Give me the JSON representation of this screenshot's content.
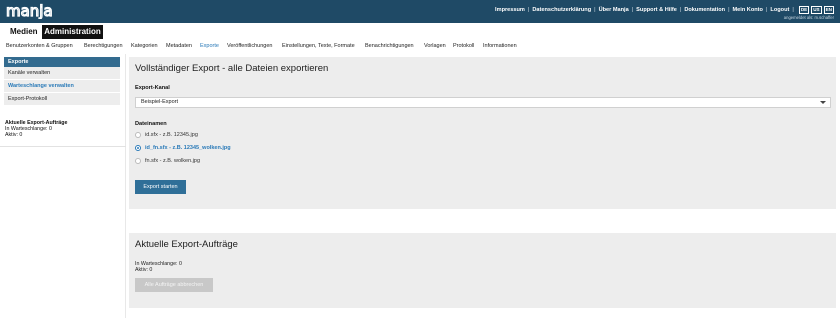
{
  "header": {
    "logo_text": "manja",
    "links": [
      "Impressum",
      "Datenschutzerklärung",
      "Über Manja",
      "Support & Hilfe",
      "Dokumentation",
      "Mein Konto",
      "Logout"
    ],
    "languages": [
      "DE",
      "US",
      "EN"
    ],
    "logged_in": "angemeldet als: m.schaffer"
  },
  "main_tabs": [
    {
      "label": "Medien",
      "active": false
    },
    {
      "label": "Administration",
      "active": true
    }
  ],
  "subnav": [
    {
      "label": "Benutzerkonten & Gruppen",
      "active": false
    },
    {
      "label": "Berechtigungen",
      "active": false
    },
    {
      "label": "Kategorien",
      "active": false
    },
    {
      "label": "Metadaten",
      "active": false
    },
    {
      "label": "Exporte",
      "active": true
    },
    {
      "label": "Veröffentlichungen",
      "active": false
    },
    {
      "label": "Einstellungen, Texte, Formate",
      "active": false
    },
    {
      "label": "Benachrichtigungen",
      "active": false
    },
    {
      "label": "Vorlagen",
      "active": false
    },
    {
      "label": "Protokoll",
      "active": false
    },
    {
      "label": "Informationen",
      "active": false
    }
  ],
  "sidebar": {
    "heading": "Exporte",
    "items": [
      {
        "label": "Kanäle verwalten",
        "active": false
      },
      {
        "label": "Warteschlange verwalten",
        "active": true
      },
      {
        "label": "Export-Protokoll",
        "active": false
      }
    ],
    "status_title": "Aktuelle Export-Aufträge",
    "status_queue": "In Warteschlange: 0",
    "status_active": "Aktiv: 0"
  },
  "export_panel": {
    "title": "Vollständiger Export - alle Dateien exportieren",
    "channel_label": "Export-Kanal",
    "channel_value": "Beispiel-Export",
    "filenames_label": "Dateinamen",
    "filename_options": [
      {
        "label": "id.sfx - z.B. 12345.jpg",
        "selected": false
      },
      {
        "label": "id_fn.sfx - z.B. 12345_wolken.jpg",
        "selected": true
      },
      {
        "label": "fn.sfx - z.B. wolken.jpg",
        "selected": false
      }
    ],
    "start_button": "Export starten"
  },
  "jobs_panel": {
    "title": "Aktuelle Export-Aufträge",
    "queue": "In Warteschlange: 0",
    "active": "Aktiv: 0",
    "cancel_button": "Alle Aufträge abbrechen"
  },
  "colors": {
    "topbar": "#1f4a66",
    "accent": "#2a7ab8",
    "primary_button": "#2f6f98",
    "panel_bg": "#ededed"
  }
}
